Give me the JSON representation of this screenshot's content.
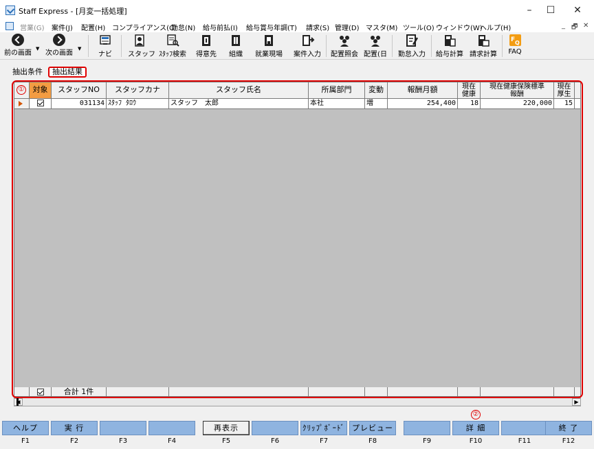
{
  "window": {
    "title": "Staff Express - [月変一括処理]",
    "controls": {
      "minimize": "–",
      "maximize": "☐",
      "close": "✕"
    },
    "mdi_controls": {
      "minimize": "_",
      "restore": "🗗",
      "close": "✕"
    }
  },
  "menu": [
    {
      "label": "営業(G)",
      "disabled": true
    },
    {
      "label": "案件(J)",
      "disabled": false
    },
    {
      "label": "配置(H)",
      "disabled": false
    },
    {
      "label": "コンプライアンス(C)",
      "disabled": false
    },
    {
      "label": "勤怠(N)",
      "disabled": false
    },
    {
      "label": "給与前払(I)",
      "disabled": false
    },
    {
      "label": "給与賞与年調(T)",
      "disabled": false
    },
    {
      "label": "請求(S)",
      "disabled": false
    },
    {
      "label": "管理(D)",
      "disabled": false
    },
    {
      "label": "マスタ(M)",
      "disabled": false
    },
    {
      "label": "ツール(O)",
      "disabled": false
    },
    {
      "label": "ウィンドウ(W)",
      "disabled": false
    },
    {
      "label": "ヘルプ(H)",
      "disabled": false
    }
  ],
  "toolbar": {
    "back": {
      "label": "前の画面",
      "icon": "back-arrow-icon"
    },
    "forward": {
      "label": "次の画面",
      "icon": "forward-arrow-icon"
    },
    "buttons": [
      {
        "label": "ナビ",
        "icon": "navi-icon"
      },
      {
        "label": "スタッフ",
        "icon": "staff-icon"
      },
      {
        "label": "ｽﾀｯﾌ検索",
        "icon": "staff-search-icon"
      },
      {
        "label": "得意先",
        "icon": "customer-icon"
      },
      {
        "label": "組織",
        "icon": "organization-icon"
      },
      {
        "label": "就業現場",
        "icon": "worksite-icon"
      },
      {
        "label": "案件入力",
        "icon": "case-input-icon"
      },
      {
        "label": "配置照会",
        "icon": "assignment-inquiry-icon"
      },
      {
        "label": "配置(日",
        "icon": "assignment-daily-icon"
      },
      {
        "label": "勤怠入力",
        "icon": "attendance-input-icon"
      },
      {
        "label": "給与計算",
        "icon": "payroll-calc-icon"
      },
      {
        "label": "請求計算",
        "icon": "billing-calc-icon"
      },
      {
        "label": "FAQ",
        "icon": "faq-icon"
      }
    ]
  },
  "tabs": [
    {
      "label": "抽出条件",
      "active": false
    },
    {
      "label": "抽出結果",
      "active": true
    }
  ],
  "grid": {
    "headers": [
      "対象",
      "スタッフNO",
      "スタッフカナ",
      "スタッフ氏名",
      "所属部門",
      "変動",
      "報酬月額",
      "現在|健康",
      "現在健康保険標準|報酬",
      "現在|厚生"
    ],
    "rows": [
      {
        "checked": true,
        "staff_no": "031134",
        "kana": "ｽﾀｯﾌ ﾀﾛｳ",
        "name": "スタッフ　太郎",
        "dept": "本社",
        "change": "増",
        "monthly_pay": "254,400",
        "health_grade": "18",
        "health_std": "220,000",
        "pension_grade": "15"
      }
    ],
    "footer": {
      "total_label": "合計 1件",
      "checked": true
    }
  },
  "callouts": {
    "one": "①",
    "two": "②"
  },
  "fkeys": [
    {
      "label": "ヘルプ",
      "key": "F1",
      "active": true
    },
    {
      "label": "実 行",
      "key": "F2",
      "active": true
    },
    {
      "label": "",
      "key": "F3",
      "active": true
    },
    {
      "label": "",
      "key": "F4",
      "active": true
    },
    {
      "label": "再表示",
      "key": "F5",
      "active": false
    },
    {
      "label": "",
      "key": "F6",
      "active": true
    },
    {
      "label": "ｸﾘｯﾌﾟﾎﾞｰﾄﾞ",
      "key": "F7",
      "active": true
    },
    {
      "label": "プレビュー",
      "key": "F8",
      "active": true
    },
    {
      "label": "",
      "key": "F9",
      "active": true
    },
    {
      "label": "詳 細",
      "key": "F10",
      "active": true
    },
    {
      "label": "",
      "key": "F11",
      "active": true
    },
    {
      "label": "終 了",
      "key": "F12",
      "active": true
    }
  ]
}
